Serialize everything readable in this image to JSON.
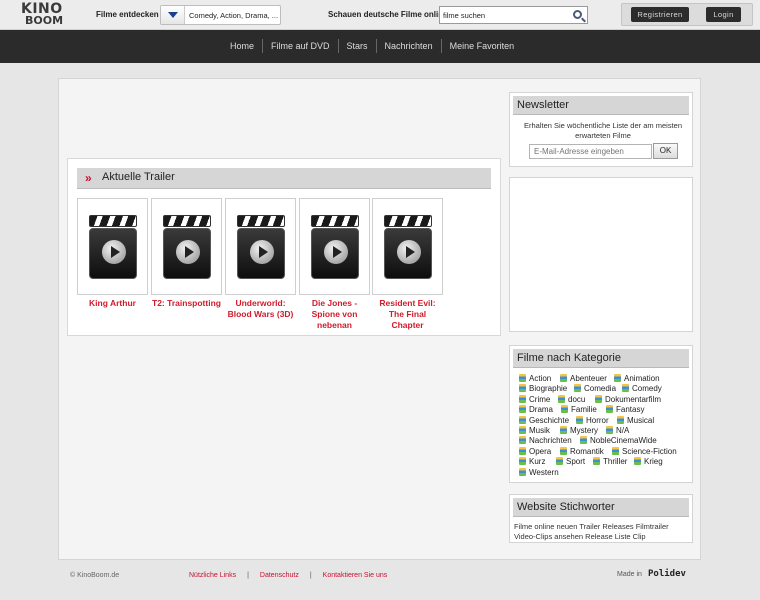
{
  "header": {
    "logo_line1": "KINO",
    "logo_line2": "BOOM",
    "discover_label": "Filme entdecken",
    "genre_select_value": "Comedy, Action, Drama, ...",
    "watch_label": "Schauen deutsche Filme online",
    "search_value": "filme suchen",
    "register_label": "Registrieren",
    "login_label": "Login"
  },
  "nav": {
    "items": [
      "Home",
      "Filme auf DVD",
      "Stars",
      "Nachrichten",
      "Meine Favoriten"
    ]
  },
  "trailers": {
    "title": "Aktuelle Trailer",
    "items": [
      {
        "title": "King Arthur"
      },
      {
        "title": "T2: Trainspotting"
      },
      {
        "title": "Underworld: Blood Wars (3D)"
      },
      {
        "title": "Die Jones - Spione von nebenan"
      },
      {
        "title": "Resident Evil: The Final Chapter"
      }
    ]
  },
  "newsletter": {
    "title": "Newsletter",
    "text": "Erhalten Sie wöchentliche Liste der am meisten erwarteten Filme",
    "email_placeholder": "E-Mail-Adresse eingeben",
    "ok_label": "OK"
  },
  "categories": {
    "title": "Filme nach Kategorie",
    "items": [
      "Action",
      "Abenteuer",
      "Animation",
      "Biographie",
      "Comedia",
      "Comedy",
      "Crime",
      "docu",
      "Dokumentarfilm",
      "Drama",
      "Familie",
      "Fantasy",
      "Geschichte",
      "Horror",
      "Musical",
      "Musik",
      "Mystery",
      "N/A",
      "Nachrichten",
      "NobleCinemaWide",
      "Opera",
      "Romantik",
      "Science-Fiction",
      "Kurz",
      "Sport",
      "Thriller",
      "Krieg",
      "Western"
    ]
  },
  "keywords": {
    "title": "Website Stichworter",
    "text": "Filme online neuen Trailer Releases Filmtrailer Video-Clips ansehen Release Liste Clip"
  },
  "footer": {
    "copyright": "© KinoBoom.de",
    "links": [
      "Nützliche Links",
      "Datenschutz",
      "Kontaktieren Sie uns"
    ],
    "separator": "|",
    "made_in": "Made in",
    "brand": "Polidev"
  },
  "colors": {
    "accent_red": "#c8102e",
    "nav_bg": "#2b2b2b",
    "category_icon": "multicolor-book-icon"
  }
}
